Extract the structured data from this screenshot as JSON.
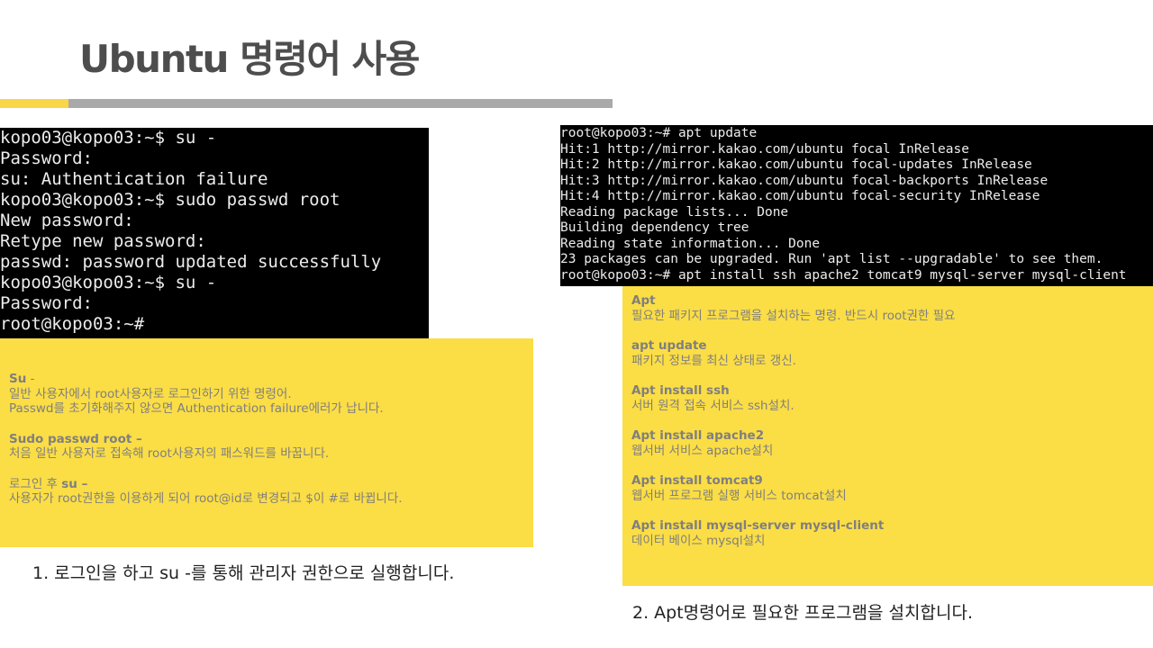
{
  "slide": {
    "title": "Ubuntu 명령어 사용",
    "colors": {
      "accent_yellow": "#fbdd45",
      "gray_bar": "#a9a9a9",
      "title_text": "#4d4d4d"
    }
  },
  "terminal_left": {
    "lines": [
      "kopo03@kopo03:~$ su -",
      "Password:",
      "su: Authentication failure",
      "kopo03@kopo03:~$ sudo passwd root",
      "New password:",
      "Retype new password:",
      "passwd: password updated successfully",
      "kopo03@kopo03:~$ su -",
      "Password:",
      "root@kopo03:~#"
    ]
  },
  "terminal_right": {
    "lines": [
      "root@kopo03:~# apt update",
      "Hit:1 http://mirror.kakao.com/ubuntu focal InRelease",
      "Hit:2 http://mirror.kakao.com/ubuntu focal-updates InRelease",
      "Hit:3 http://mirror.kakao.com/ubuntu focal-backports InRelease",
      "Hit:4 http://mirror.kakao.com/ubuntu focal-security InRelease",
      "Reading package lists... Done",
      "Building dependency tree",
      "Reading state information... Done",
      "23 packages can be upgraded. Run 'apt list --upgradable' to see them.",
      "root@kopo03:~# apt install ssh apache2 tomcat9 mysql-server mysql-client"
    ]
  },
  "note_left": {
    "su_title": "Su",
    "su_dash": " -",
    "su_line1": "일반 사용자에서 root사용자로 로그인하기 위한 명령어.",
    "su_line2": "Passwd를 초기화해주지 않으면 Authentication failure에러가 납니다.",
    "sudo_title": "Sudo passwd root –",
    "sudo_line1": "처음 일반 사용자로 접속해 root사용자의 패스워드를 바꿉니다.",
    "login_prefix": "로그인 후 ",
    "login_cmd": "su –",
    "login_line1": "사용자가 root권한을 이용하게 되어 root@id로 변경되고 $이 #로 바뀝니다."
  },
  "note_right": {
    "items": [
      {
        "title": "Apt",
        "desc": "필요한 패키지 프로그램을 설치하는 명령. 반드시 root권한 필요"
      },
      {
        "title": "apt update",
        "desc": "패키지 정보를 최신 상태로 갱신."
      },
      {
        "title": "Apt install ssh",
        "desc": "서버 원격 접속 서비스 ssh설치."
      },
      {
        "title": "Apt install apache2",
        "desc": "웹서버 서비스 apache설치"
      },
      {
        "title": "Apt install tomcat9",
        "desc": "웹서버 프로그램 실행 서비스 tomcat설치"
      },
      {
        "title": "Apt install mysql-server mysql-client",
        "desc": "데이터 베이스 mysql설치"
      }
    ]
  },
  "captions": {
    "left": "1. 로그인을 하고 su -를 통해 관리자 권한으로 실행합니다.",
    "right": "2. Apt명령어로 필요한 프로그램을 설치합니다."
  }
}
